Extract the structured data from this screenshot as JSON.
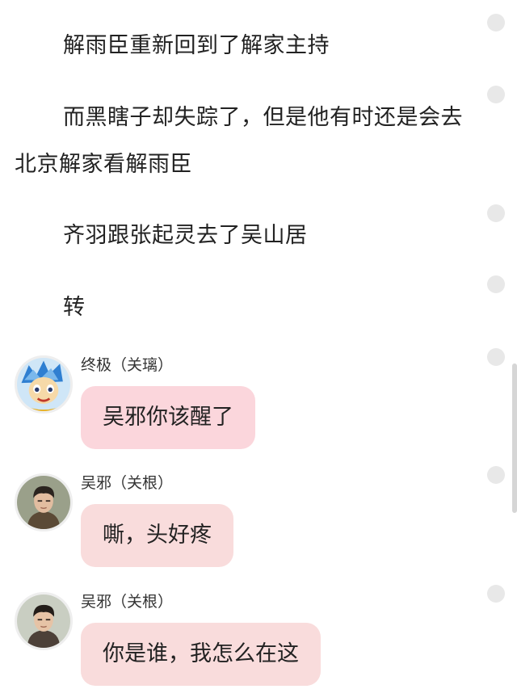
{
  "story": {
    "paragraphs": [
      "解雨臣重新回到了解家主持",
      "而黑瞎子却失踪了，但是他有时还是会去北京解家看解雨臣",
      "齐羽跟张起灵去了吴山居",
      "转"
    ]
  },
  "chat": {
    "messages": [
      {
        "sender": "终极（关璃）",
        "text": "吴邪你该醒了",
        "bubble_color": "#fbd6dc"
      },
      {
        "sender": "吴邪（关根）",
        "text": "嘶，头好疼",
        "bubble_color": "#f9dcdc"
      },
      {
        "sender": "吴邪（关根）",
        "text": "你是谁，我怎么在这",
        "bubble_color": "#f9dcdc"
      }
    ]
  },
  "icons": {
    "avatar_1": "anime-character-avatar",
    "avatar_2": "male-portrait-avatar",
    "avatar_3": "male-portrait-avatar",
    "comment_dot": "comment-dot-icon"
  }
}
